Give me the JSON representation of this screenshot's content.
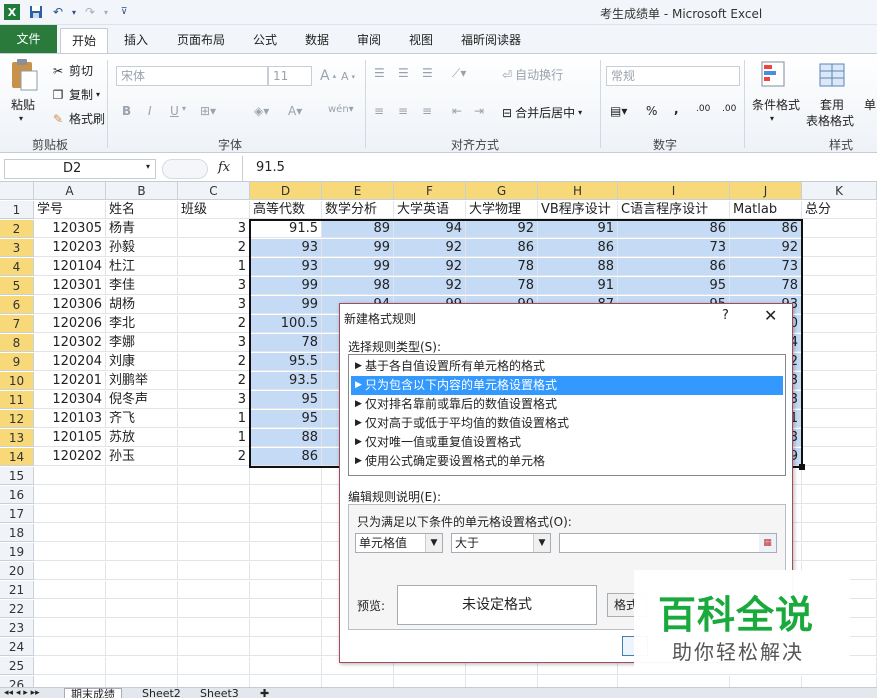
{
  "window": {
    "title": "考生成绩单 - Microsoft Excel"
  },
  "ribbon_tabs": [
    "文件",
    "开始",
    "插入",
    "页面布局",
    "公式",
    "数据",
    "审阅",
    "视图",
    "福昕阅读器"
  ],
  "clipboard": {
    "paste": "粘贴",
    "cut": "剪切",
    "copy": "复制",
    "painter": "格式刷",
    "group": "剪贴板"
  },
  "font": {
    "name": "宋体",
    "size": "11",
    "bold": "B",
    "italic": "I",
    "underline": "U",
    "group": "字体"
  },
  "alignment": {
    "wrap": "自动换行",
    "merge": "合并后居中",
    "group": "对齐方式"
  },
  "number": {
    "format": "常规",
    "percent": "%",
    "comma": ",",
    "group": "数字"
  },
  "styles": {
    "conditional": "条件格式",
    "table": "套用",
    "table2": "表格格式",
    "cell": "单",
    "group": "样式"
  },
  "formula_bar": {
    "name_box": "D2",
    "fx": "fx",
    "value": "91.5"
  },
  "columns": [
    "A",
    "B",
    "C",
    "D",
    "E",
    "F",
    "G",
    "H",
    "I",
    "J",
    "K"
  ],
  "rows": [
    "1",
    "2",
    "3",
    "4",
    "5",
    "6",
    "7",
    "8",
    "9",
    "10",
    "11",
    "12",
    "13",
    "14",
    "15",
    "16",
    "17",
    "18",
    "19",
    "20",
    "21",
    "22",
    "23",
    "24",
    "25",
    "26",
    "27"
  ],
  "headers": [
    "学号",
    "姓名",
    "班级",
    "高等代数",
    "数学分析",
    "大学英语",
    "大学物理",
    "VB程序设计",
    "C语言程序设计",
    "Matlab",
    "总分"
  ],
  "table": [
    [
      "120305",
      "杨青",
      "3",
      "91.5",
      "89",
      "94",
      "92",
      "91",
      "86",
      "86"
    ],
    [
      "120203",
      "孙毅",
      "2",
      "93",
      "99",
      "92",
      "86",
      "86",
      "73",
      "92"
    ],
    [
      "120104",
      "杜江",
      "1",
      "93",
      "99",
      "92",
      "78",
      "88",
      "86",
      "73"
    ],
    [
      "120301",
      "李佳",
      "3",
      "99",
      "98",
      "92",
      "78",
      "91",
      "95",
      "78"
    ],
    [
      "120306",
      "胡杨",
      "3",
      "99",
      "94",
      "99",
      "90",
      "87",
      "95",
      "93"
    ],
    [
      "120206",
      "李北",
      "2",
      "100.5",
      "",
      "",
      "",
      "",
      "",
      "0"
    ],
    [
      "120302",
      "李娜",
      "3",
      "78",
      "",
      "",
      "",
      "",
      "",
      "4"
    ],
    [
      "120204",
      "刘康",
      "2",
      "95.5",
      "",
      "",
      "",
      "",
      "",
      "2"
    ],
    [
      "120201",
      "刘鹏举",
      "2",
      "93.5",
      "",
      "",
      "",
      "",
      "",
      "3"
    ],
    [
      "120304",
      "倪冬声",
      "3",
      "95",
      "",
      "",
      "",
      "",
      "",
      "3"
    ],
    [
      "120103",
      "齐飞",
      "1",
      "95",
      "",
      "",
      "",
      "",
      "",
      "1"
    ],
    [
      "120105",
      "苏放",
      "1",
      "88",
      "",
      "",
      "",
      "",
      "",
      "3"
    ],
    [
      "120202",
      "孙玉",
      "2",
      "86",
      "",
      "",
      "",
      "",
      "",
      "9"
    ]
  ],
  "dialog": {
    "title": "新建格式规则",
    "help": "?",
    "close": "✕",
    "select_label": "选择规则类型(S):",
    "rule_types": [
      "基于各自值设置所有单元格的格式",
      "只为包含以下内容的单元格设置格式",
      "仅对排名靠前或靠后的数值设置格式",
      "仅对高于或低于平均值的数值设置格式",
      "仅对唯一值或重复值设置格式",
      "使用公式确定要设置格式的单元格"
    ],
    "selected_index": 1,
    "edit_label": "编辑规则说明(E):",
    "condition_label": "只为满足以下条件的单元格设置格式(O):",
    "operand": "单元格值",
    "operator": "大于",
    "value": "",
    "preview_label": "预览:",
    "preview_text": "未设定格式",
    "format_button": "格式"
  },
  "watermark": {
    "big": "百科全说",
    "small": "助你轻松解决"
  },
  "sheet_tabs": [
    "期末成绩",
    "Sheet2",
    "Sheet3"
  ]
}
